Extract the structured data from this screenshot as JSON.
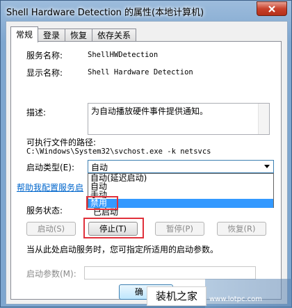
{
  "window": {
    "title": "Shell Hardware Detection 的属性(本地计算机)"
  },
  "tabs": [
    "常规",
    "登录",
    "恢复",
    "依存关系"
  ],
  "general": {
    "service_name_label": "服务名称:",
    "service_name_value": "ShellHWDetection",
    "display_name_label": "显示名称:",
    "display_name_value": "Shell Hardware Detection",
    "description_label": "描述:",
    "description_value": "为自动播放硬件事件提供通知。",
    "exe_path_label": "可执行文件的路径:",
    "exe_path_value": "C:\\Windows\\System32\\svchost.exe -k netsvcs",
    "startup_type_label": "启动类型(E):",
    "startup_type_value": "自动",
    "startup_type_options": [
      "自动(延迟启动)",
      "自动",
      "手动",
      "禁用"
    ],
    "startup_type_highlighted": "禁用",
    "help_link": "帮助我配置服务启",
    "status_label": "服务状态:",
    "status_value": "已启动",
    "buttons": {
      "start": "启动(S)",
      "stop": "停止(T)",
      "pause": "暂停(P)",
      "resume": "恢复(R)"
    },
    "hint": "当从此处启动服务时，您可指定所适用的启动参数。",
    "start_params_label": "启动参数(M):",
    "start_params_value": ""
  },
  "footer": {
    "ok_partial": "确"
  },
  "watermark": {
    "text": "装机之家",
    "url": "www.lotpc.com"
  },
  "colors": {
    "highlight": "#3399ff",
    "annotation_red": "#e0303a",
    "link": "#0066cc"
  }
}
